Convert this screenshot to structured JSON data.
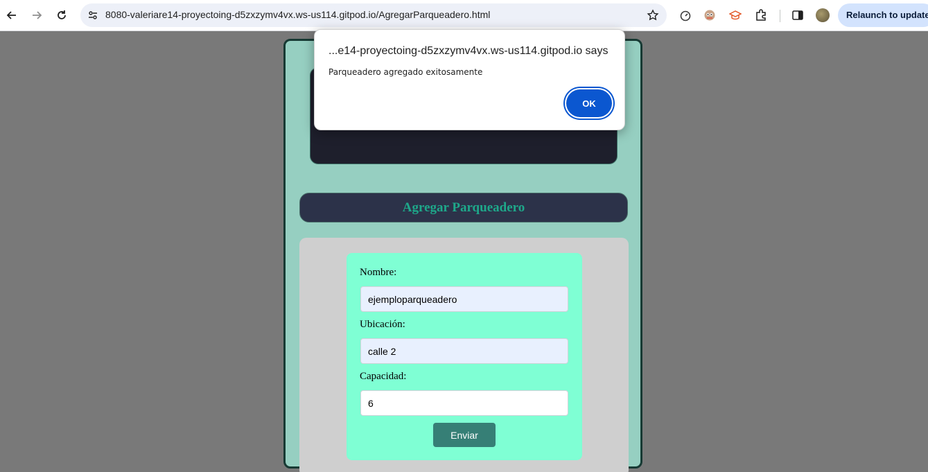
{
  "browser": {
    "url": "8080-valeriare14-proyectoing-d5zxzymv4vx.ws-us114.gitpod.io/AgregarParqueadero.html",
    "relaunch_label": "Relaunch to update"
  },
  "dialog": {
    "title": "...e14-proyectoing-d5zxzymv4vx.ws-us114.gitpod.io says",
    "message": "Parqueadero agregado exitosamente",
    "ok_label": "OK"
  },
  "page": {
    "heading": "Agregar Parqueadero",
    "form": {
      "nombre_label": "Nombre:",
      "nombre_value": "ejemploparqueadero",
      "ubicacion_label": "Ubicación:",
      "ubicacion_value": "calle 2",
      "capacidad_label": "Capacidad:",
      "capacidad_value": "6",
      "submit_label": "Enviar"
    }
  },
  "colors": {
    "page_bg": "#96cfc1",
    "heading_color": "#1ea88a",
    "form_bg": "#7fffd4",
    "submit_bg": "#367f76",
    "ok_button": "#0b57d0"
  }
}
